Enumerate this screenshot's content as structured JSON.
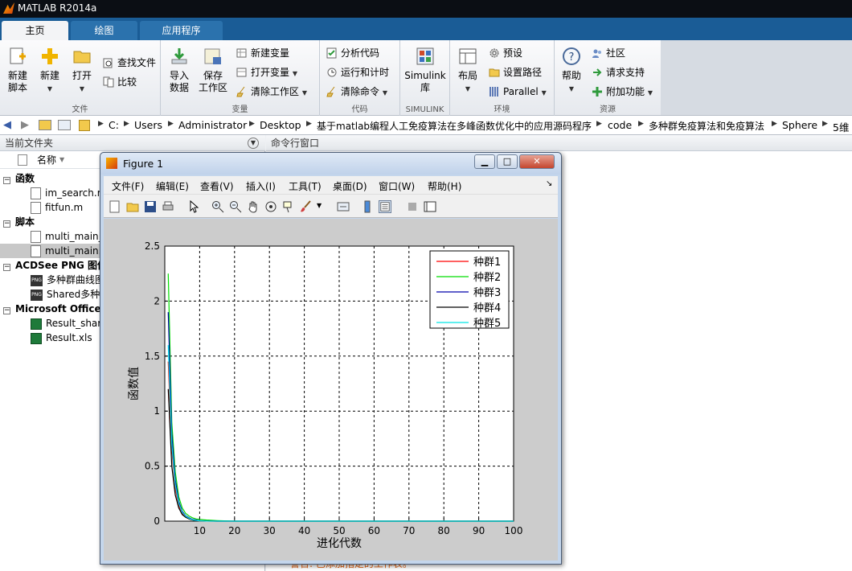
{
  "window": {
    "title": "MATLAB R2014a"
  },
  "tabs": [
    "主页",
    "绘图",
    "应用程序"
  ],
  "ribbon": {
    "file": {
      "group": "文件",
      "new_script": [
        "新建",
        "脚本"
      ],
      "new": "新建",
      "open": "打开",
      "find_files": "查找文件",
      "compare": "比较"
    },
    "variable": {
      "group": "变量",
      "import": [
        "导入",
        "数据"
      ],
      "save": [
        "保存",
        "工作区"
      ],
      "new_var": "新建变量",
      "open_var": "打开变量",
      "clear_ws": "清除工作区"
    },
    "code": {
      "group": "代码",
      "analyze": "分析代码",
      "run_time": "运行和计时",
      "clear_cmd": "清除命令"
    },
    "simulink": {
      "group": "SIMULINK",
      "label": [
        "Simulink",
        "库"
      ]
    },
    "env": {
      "group": "环境",
      "layout": "布局",
      "prefs": "预设",
      "set_path": "设置路径",
      "parallel": "Parallel"
    },
    "resources": {
      "group": "资源",
      "help": "帮助",
      "community": "社区",
      "support": "请求支持",
      "addons": "附加功能"
    }
  },
  "address": [
    "C:",
    "Users",
    "Administrator",
    "Desktop",
    "基于matlab编程人工免疫算法在多峰函数优化中的应用源码程序",
    "code",
    "多种群免疫算法和免疫算法",
    "Sphere",
    "5维"
  ],
  "current_folder": {
    "title": "当前文件夹",
    "column": "名称",
    "groups": [
      {
        "name": "函数",
        "items": [
          "im_search.m",
          "fitfun.m"
        ]
      },
      {
        "name": "脚本",
        "items": [
          "multi_main_",
          "multi_main."
        ]
      },
      {
        "name": "ACDSee PNG 图像",
        "items": [
          "多种群曲线图",
          "Shared多种"
        ]
      },
      {
        "name": "Microsoft Office",
        "items": [
          "Result_shar",
          "Result.xls"
        ]
      }
    ]
  },
  "command_window": {
    "title": "命令行窗口",
    "warning": "警告: 已添加指定的工作表。"
  },
  "figure": {
    "title": "Figure 1",
    "menu": [
      "文件(F)",
      "编辑(E)",
      "查看(V)",
      "插入(I)",
      "工具(T)",
      "桌面(D)",
      "窗口(W)",
      "帮助(H)"
    ],
    "colors": {
      "s1": "#ff0000",
      "s2": "#00dd00",
      "s3": "#0000aa",
      "s4": "#000000",
      "s5": "#00e5e5"
    }
  },
  "chart_data": {
    "type": "line",
    "xlabel": "进化代数",
    "ylabel": "函数值",
    "xlim": [
      0,
      100
    ],
    "ylim": [
      0,
      2.5
    ],
    "xticks": [
      10,
      20,
      30,
      40,
      50,
      60,
      70,
      80,
      90,
      100
    ],
    "yticks": [
      0,
      0.5,
      1,
      1.5,
      2,
      2.5
    ],
    "grid": true,
    "legend_position": "top-right",
    "x": [
      1,
      2,
      3,
      4,
      5,
      6,
      7,
      8,
      9,
      10,
      12,
      15,
      20,
      100
    ],
    "series": [
      {
        "name": "种群1",
        "color": "#ff0000",
        "values": [
          1.45,
          0.65,
          0.3,
          0.14,
          0.07,
          0.04,
          0.02,
          0.01,
          0.005,
          0.002,
          0.001,
          0,
          0,
          0
        ]
      },
      {
        "name": "种群2",
        "color": "#00dd00",
        "values": [
          2.25,
          0.9,
          0.45,
          0.22,
          0.12,
          0.07,
          0.045,
          0.03,
          0.02,
          0.015,
          0.01,
          0.005,
          0,
          0
        ]
      },
      {
        "name": "种群3",
        "color": "#0000aa",
        "values": [
          1.9,
          0.8,
          0.38,
          0.18,
          0.09,
          0.05,
          0.03,
          0.015,
          0.01,
          0.005,
          0.002,
          0,
          0,
          0
        ]
      },
      {
        "name": "种群4",
        "color": "#000000",
        "values": [
          1.2,
          0.5,
          0.24,
          0.12,
          0.06,
          0.035,
          0.02,
          0.01,
          0.005,
          0.002,
          0.001,
          0,
          0,
          0
        ]
      },
      {
        "name": "种群5",
        "color": "#00e5e5",
        "values": [
          1.6,
          0.7,
          0.33,
          0.16,
          0.08,
          0.045,
          0.025,
          0.012,
          0.006,
          0.003,
          0.001,
          0,
          0,
          0
        ]
      }
    ]
  }
}
